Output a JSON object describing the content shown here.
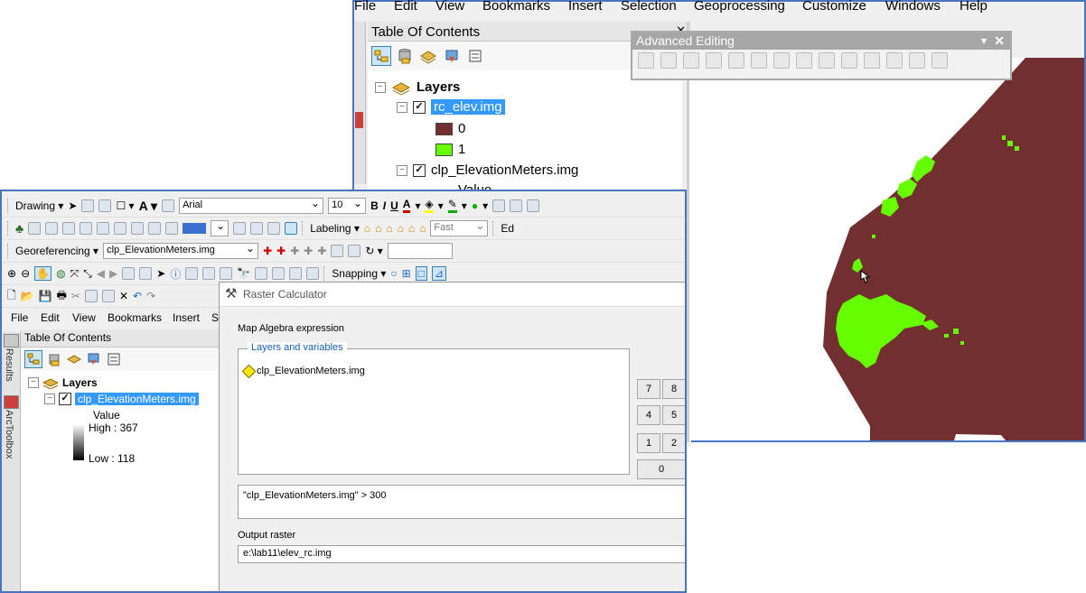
{
  "back_window": {
    "menu": [
      "File",
      "Edit",
      "View",
      "Bookmarks",
      "Insert",
      "Selection",
      "Geoprocessing",
      "Customize",
      "Windows",
      "Help"
    ],
    "toc_title": "Table Of Contents",
    "layers_label": "Layers",
    "layer1": "rc_elev.img",
    "class0": "0",
    "class1": "1",
    "layer2": "clp_ElevationMeters.img",
    "layer2_value": "Value",
    "colors": {
      "class0": "#722f2f",
      "class1": "#66ff00"
    }
  },
  "advanced_editing": {
    "title": "Advanced Editing"
  },
  "front_window": {
    "drawing_label": "Drawing",
    "font_name": "Arial",
    "font_size": "10",
    "bold": "B",
    "italic": "I",
    "underline": "U",
    "font_letter": "A",
    "labeling_label": "Labeling",
    "label_speed": "Fast",
    "partial_ed": "Ed",
    "georef_label": "Georeferencing",
    "georef_layer": "clp_ElevationMeters.img",
    "snapping_label": "Snapping",
    "menu": [
      "File",
      "Edit",
      "View",
      "Bookmarks",
      "Insert",
      "Se"
    ],
    "side_tabs": [
      "Results",
      "ArcToolbox"
    ],
    "toc_title": "Table Of Contents",
    "layers_label": "Layers",
    "layer": "clp_ElevationMeters.img",
    "value_label": "Value",
    "high": "High : 367",
    "low": "Low : 118"
  },
  "raster_calculator": {
    "title": "Raster Calculator",
    "map_algebra_label": "Map Algebra expression",
    "layers_vars_label": "Layers and variables",
    "layer_item": "clp_ElevationMeters.img",
    "keys": [
      "7",
      "8",
      "4",
      "5",
      "1",
      "2",
      "0"
    ],
    "expression": "\"clp_ElevationMeters.img\" > 300",
    "output_label": "Output raster",
    "output_path": "e:\\lab11\\elev_rc.img"
  }
}
